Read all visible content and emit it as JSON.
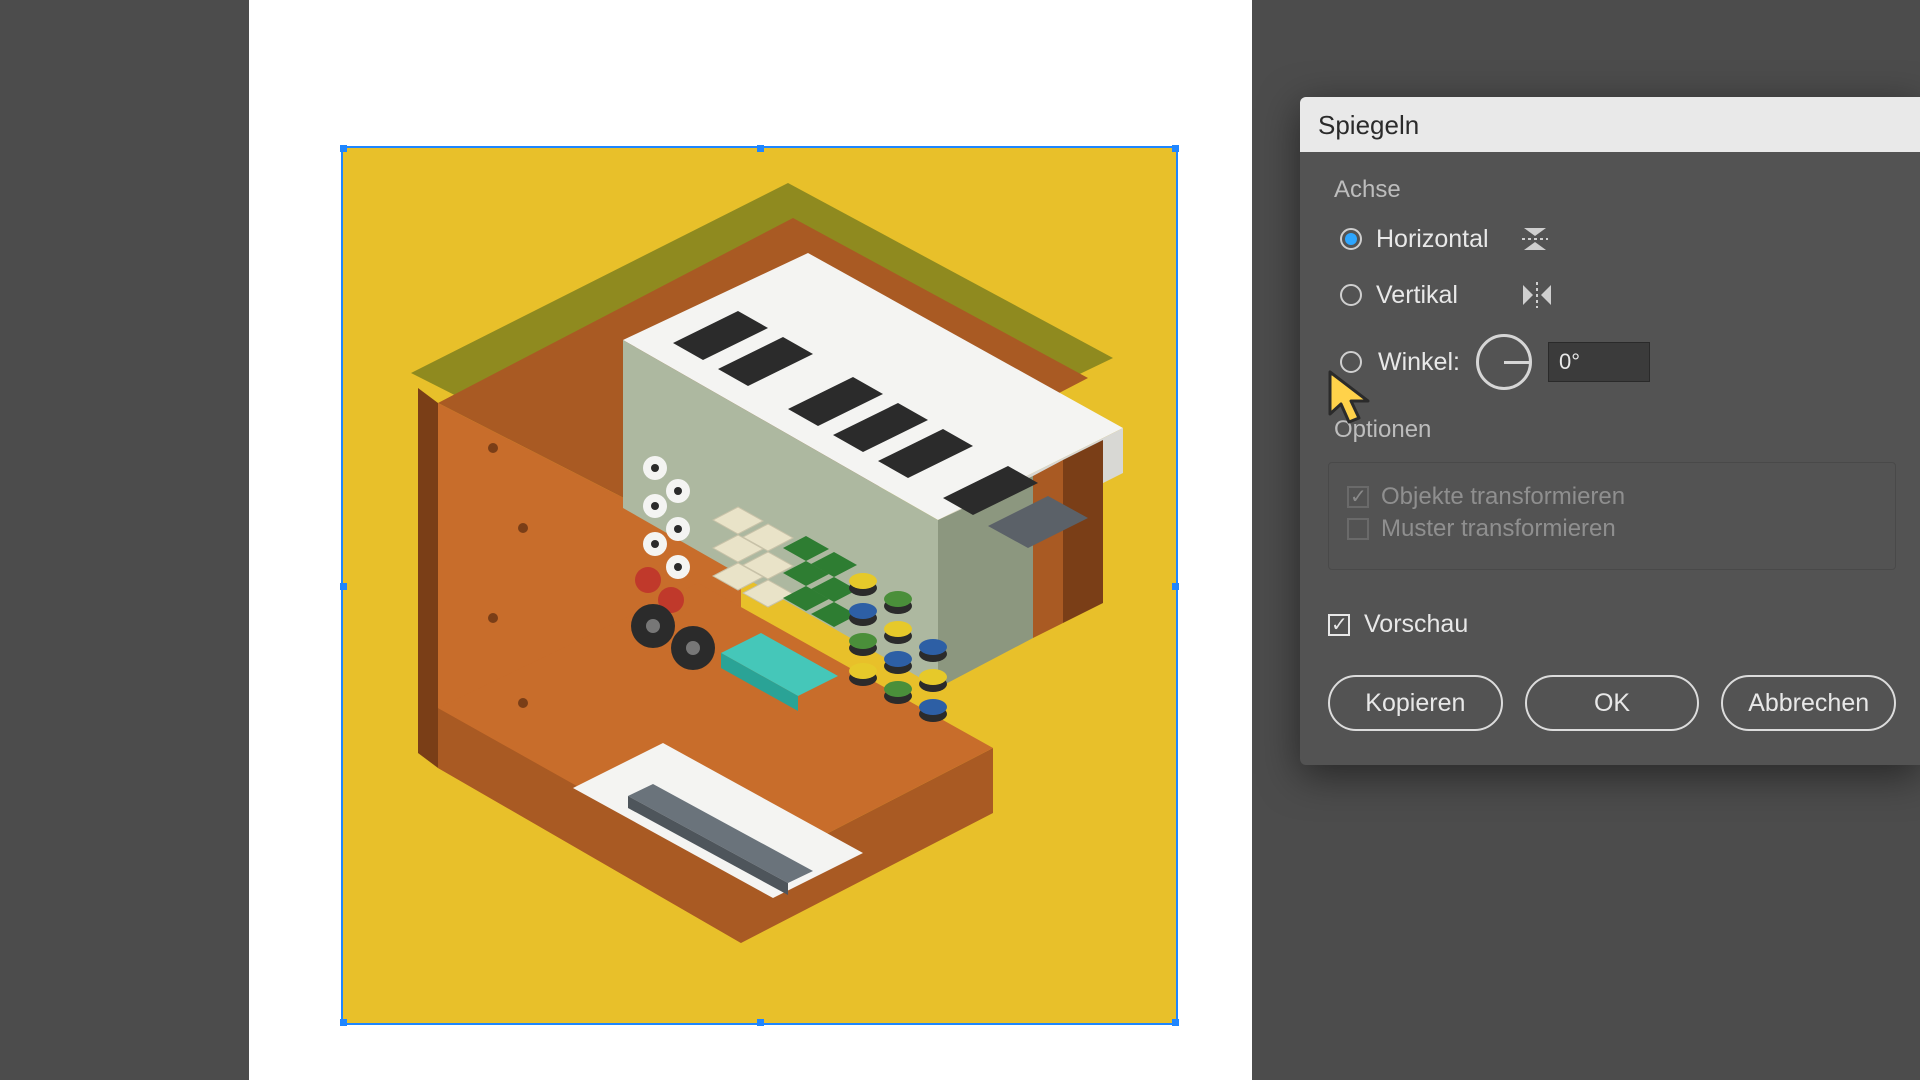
{
  "dialog": {
    "title": "Spiegeln",
    "achse_label": "Achse",
    "horizontal_label": "Horizontal",
    "horizontal_selected": true,
    "vertikal_label": "Vertikal",
    "vertikal_selected": false,
    "winkel_label": "Winkel:",
    "winkel_value": "0°",
    "optionen_label": "Optionen",
    "objekte_label": "Objekte transformieren",
    "objekte_checked": true,
    "muster_label": "Muster transformieren",
    "muster_checked": false,
    "vorschau_label": "Vorschau",
    "vorschau_checked": true,
    "kopieren_label": "Kopieren",
    "ok_label": "OK",
    "abbrechen_label": "Abbrechen"
  },
  "artwork": {
    "bg": "#e8c02a",
    "colors": {
      "wood_dark": "#a95a23",
      "wood_mid": "#c86d2b",
      "wood_shadow": "#7a3e17",
      "olive": "#8f8a1f",
      "panel": "#adb8a0",
      "panel_dark": "#8c977f",
      "white": "#f4f4f2",
      "black": "#2b2b2b",
      "grey": "#6a737b",
      "teal": "#45c7b9",
      "red": "#c0392b",
      "blue": "#2d5fa5",
      "green": "#2e7d32",
      "yellow": "#e6c92a"
    }
  }
}
